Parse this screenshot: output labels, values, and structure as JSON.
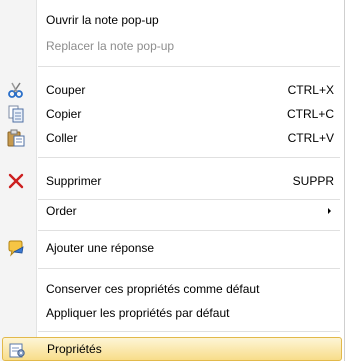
{
  "menu": {
    "open_note": "Ouvrir la note pop-up",
    "replace_note": "Replacer la note pop-up",
    "cut": {
      "label": "Couper",
      "shortcut": "CTRL+X",
      "icon": "scissors-icon"
    },
    "copy": {
      "label": "Copier",
      "shortcut": "CTRL+C",
      "icon": "copy-icon"
    },
    "paste": {
      "label": "Coller",
      "shortcut": "CTRL+V",
      "icon": "paste-icon"
    },
    "delete": {
      "label": "Supprimer",
      "shortcut": "SUPPR",
      "icon": "delete-x-icon"
    },
    "order": {
      "label": "Order",
      "icon": "submenu-arrow-icon"
    },
    "add_reply": {
      "label": "Ajouter une réponse",
      "icon": "reply-icon"
    },
    "keep_defaults": "Conserver ces propriétés comme défaut",
    "apply_defaults": "Appliquer les propriétés par défaut",
    "properties": {
      "label": "Propriétés",
      "icon": "properties-icon"
    }
  },
  "colors": {
    "highlight": "#f8dd8a",
    "delete_icon": "#cc1f1f",
    "disabled_text": "#8d8d8d"
  }
}
